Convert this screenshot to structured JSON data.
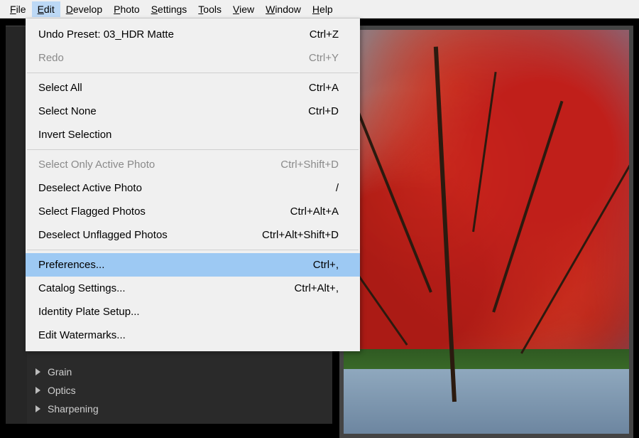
{
  "menubar": {
    "items": [
      {
        "letter": "F",
        "rest": "ile"
      },
      {
        "letter": "E",
        "rest": "dit"
      },
      {
        "letter": "D",
        "rest": "evelop"
      },
      {
        "letter": "P",
        "rest": "hoto"
      },
      {
        "letter": "S",
        "rest": "ettings"
      },
      {
        "letter": "T",
        "rest": "ools"
      },
      {
        "letter": "V",
        "rest": "iew"
      },
      {
        "letter": "W",
        "rest": "indow"
      },
      {
        "letter": "H",
        "rest": "elp"
      }
    ],
    "active_index": 1
  },
  "dropdown": {
    "items": [
      {
        "label": "Undo Preset: 03_HDR Matte",
        "shortcut": "Ctrl+Z",
        "disabled": false
      },
      {
        "label": "Redo",
        "shortcut": "Ctrl+Y",
        "disabled": true
      },
      {
        "sep": true
      },
      {
        "label": "Select All",
        "shortcut": "Ctrl+A",
        "disabled": false
      },
      {
        "label": "Select None",
        "shortcut": "Ctrl+D",
        "disabled": false
      },
      {
        "label": "Invert Selection",
        "shortcut": "",
        "disabled": false
      },
      {
        "sep": true
      },
      {
        "label": "Select Only Active Photo",
        "shortcut": "Ctrl+Shift+D",
        "disabled": true
      },
      {
        "label": "Deselect Active Photo",
        "shortcut": "/",
        "disabled": false
      },
      {
        "label": "Select Flagged Photos",
        "shortcut": "Ctrl+Alt+A",
        "disabled": false
      },
      {
        "label": "Deselect Unflagged Photos",
        "shortcut": "Ctrl+Alt+Shift+D",
        "disabled": false
      },
      {
        "sep": true
      },
      {
        "label": "Preferences...",
        "shortcut": "Ctrl+,",
        "disabled": false,
        "selected": true
      },
      {
        "label": "Catalog Settings...",
        "shortcut": "Ctrl+Alt+,",
        "disabled": false
      },
      {
        "label": "Identity Plate Setup...",
        "shortcut": "",
        "disabled": false
      },
      {
        "label": "Edit Watermarks...",
        "shortcut": "",
        "disabled": false
      }
    ]
  },
  "sidebar": {
    "panels": [
      "Grain",
      "Optics",
      "Sharpening"
    ]
  }
}
